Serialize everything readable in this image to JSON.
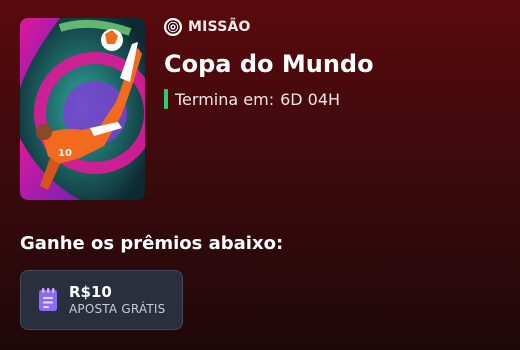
{
  "mission": {
    "badge_label": "MISSÃO",
    "badge_icon": "target-icon",
    "title": "Copa do Mundo",
    "timer_label": "Termina em:",
    "timer_value": "6D 04H",
    "image_subject": "soccer player bicycle kick"
  },
  "prizes": {
    "heading": "Ganhe os prêmios abaixo:",
    "items": [
      {
        "icon": "ticket-icon",
        "amount": "R$10",
        "type": "APOSTA GRÁTIS"
      }
    ]
  },
  "colors": {
    "background_top": "#5a0a0c",
    "background_bottom": "#1f080a",
    "timer_indicator": "#2ecc71",
    "prize_card_bg": "#2a2f3e",
    "prize_icon": "#8b6cf6"
  }
}
